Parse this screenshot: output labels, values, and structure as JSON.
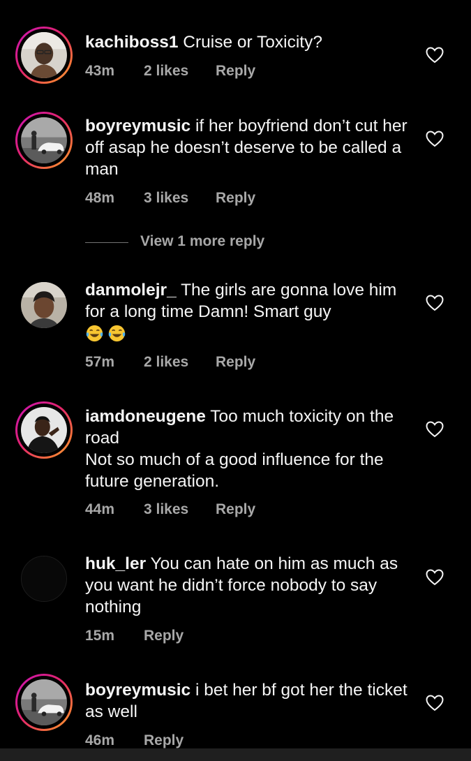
{
  "comments": [
    {
      "username": "kachiboss1",
      "text": "Cruise or Toxicity?",
      "time": "43m",
      "likes": "2 likes",
      "reply": "Reply",
      "avatar_icon": "profile-photo-man-glasses",
      "story_ring": true
    },
    {
      "username": "boyreymusic",
      "text": "if her boyfriend don’t cut her off asap he doesn’t deserve to be called a man",
      "time": "48m",
      "likes": "3 likes",
      "reply": "Reply",
      "avatar_icon": "profile-photo-car",
      "story_ring": true
    },
    {
      "username": "danmolejr_",
      "text": "The girls are gonna love him for a long time Damn! Smart guy",
      "emoji": "😂😂",
      "time": "57m",
      "likes": "2 likes",
      "reply": "Reply",
      "avatar_icon": "profile-photo-man-durag",
      "story_ring": false
    },
    {
      "username": "iamdoneugene",
      "text": "Too much toxicity on the road",
      "text_line2": "Not so much of a good influence for the future generation.",
      "time": "44m",
      "likes": "3 likes",
      "reply": "Reply",
      "avatar_icon": "profile-photo-man-pose",
      "story_ring": true
    },
    {
      "username": "huk_ler",
      "text": "You can hate on him as much as you want he didn’t force nobody to say nothing",
      "time": "15m",
      "reply": "Reply",
      "avatar_icon": "profile-photo-dark",
      "story_ring": false
    },
    {
      "username": "boyreymusic",
      "text": "i bet her bf got her the ticket as well",
      "time": "46m",
      "reply": "Reply",
      "avatar_icon": "profile-photo-car",
      "story_ring": true
    }
  ],
  "view_more_replies": "View 1 more reply",
  "heart_icon": "heart-outline-icon",
  "colors": {
    "background": "#000000",
    "text": "#f5f5f5",
    "secondary_text": "#a8a8a8",
    "story_ring_start": "#c913b9",
    "story_ring_end": "#fbb03b"
  }
}
